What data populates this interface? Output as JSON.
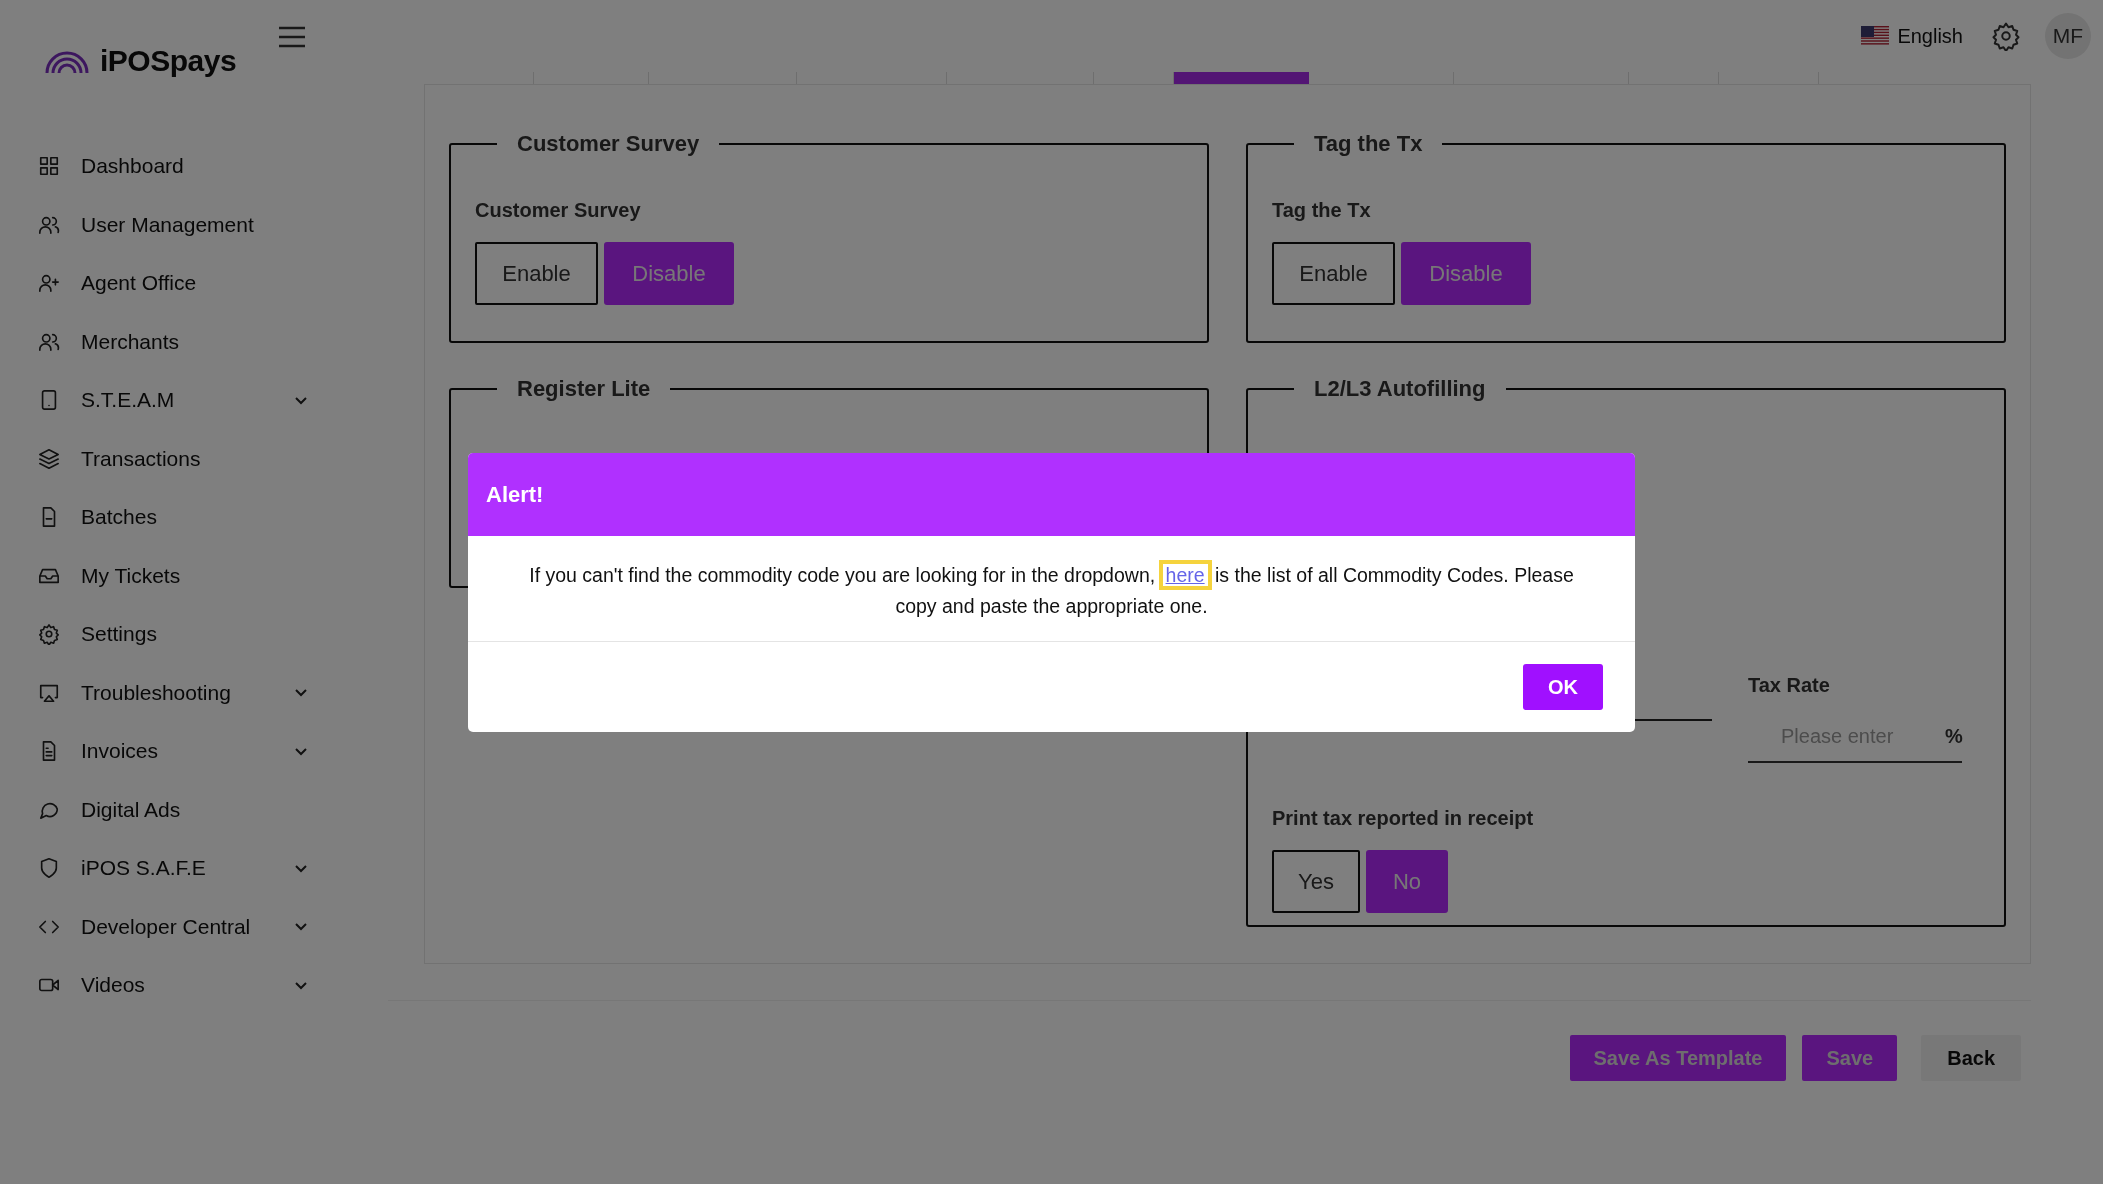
{
  "header": {
    "logo": "iPOSpays",
    "language": "English",
    "avatar": "MF"
  },
  "sidebar": {
    "items": [
      {
        "label": "Dashboard",
        "expandable": false
      },
      {
        "label": "User Management",
        "expandable": false
      },
      {
        "label": "Agent Office",
        "expandable": false
      },
      {
        "label": "Merchants",
        "expandable": false
      },
      {
        "label": "S.T.E.A.M",
        "expandable": true
      },
      {
        "label": "Transactions",
        "expandable": false
      },
      {
        "label": "Batches",
        "expandable": false
      },
      {
        "label": "My Tickets",
        "expandable": false
      },
      {
        "label": "Settings",
        "expandable": false
      },
      {
        "label": "Troubleshooting",
        "expandable": true
      },
      {
        "label": "Invoices",
        "expandable": true
      },
      {
        "label": "Digital Ads",
        "expandable": false
      },
      {
        "label": "iPOS S.A.F.E",
        "expandable": true
      },
      {
        "label": "Developer Central",
        "expandable": true
      },
      {
        "label": "Videos",
        "expandable": true
      }
    ]
  },
  "tabs": [
    {
      "selected": false
    },
    {
      "selected": false
    },
    {
      "selected": false
    },
    {
      "selected": false
    },
    {
      "selected": false
    },
    {
      "selected": false
    },
    {
      "selected": true
    },
    {
      "selected": false
    },
    {
      "selected": false
    },
    {
      "selected": false
    },
    {
      "selected": false
    }
  ],
  "sections": [
    {
      "kind": "toggle",
      "legend": "Customer Survey",
      "label": "Customer Survey",
      "options": [
        {
          "label": "Enable",
          "selected": false
        },
        {
          "label": "Disable",
          "selected": true
        }
      ]
    },
    {
      "kind": "toggle",
      "legend": "Tag the Tx",
      "label": "Tag the Tx",
      "options": [
        {
          "label": "Enable",
          "selected": false
        },
        {
          "label": "Disable",
          "selected": true
        }
      ]
    },
    {
      "kind": "plain",
      "legend": "Register Lite"
    },
    {
      "kind": "tax",
      "legend": "L2/L3 Autofilling",
      "tax_rate": {
        "label": "Tax Rate",
        "placeholder": "Please enter",
        "suffix": "%"
      },
      "print_tax": {
        "label": "Print tax reported in receipt",
        "options": [
          {
            "label": "Yes",
            "selected": false
          },
          {
            "label": "No",
            "selected": true
          }
        ]
      }
    }
  ],
  "actions": [
    {
      "label": "Save As Template",
      "kind": "primary"
    },
    {
      "label": "Save",
      "kind": "primary"
    },
    {
      "label": "Back",
      "kind": "secondary"
    }
  ],
  "alert": {
    "title": "Alert!",
    "message_before": "If you can't find the commodity code you are looking for in the dropdown, ",
    "link": "here",
    "message_after": " is the list of all Commodity Codes. Please copy and paste the appropriate one.",
    "button": "OK"
  }
}
